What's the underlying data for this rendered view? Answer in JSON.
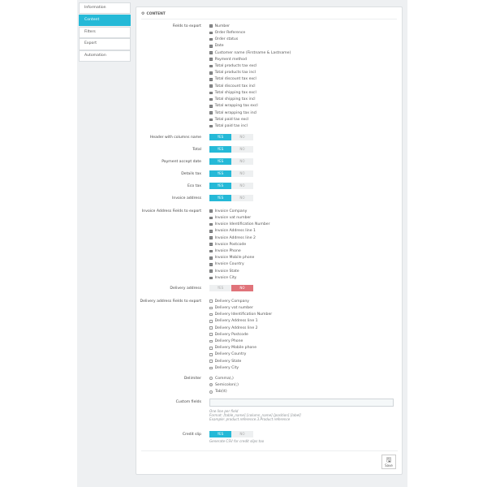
{
  "sidebar": {
    "items": [
      {
        "label": "Information"
      },
      {
        "label": "Content"
      },
      {
        "label": "Filters"
      },
      {
        "label": "Export"
      },
      {
        "label": "Automation"
      }
    ]
  },
  "panel": {
    "title": "CONTENT"
  },
  "fields_to_export": {
    "label": "Fields to export",
    "items": [
      "Number",
      "Order Reference",
      "Order status",
      "Date",
      "Customer name (Firstname & Lastname)",
      "Payment method",
      "Total products tax excl",
      "Total products tax incl",
      "Total discount tax excl",
      "Total discount tax incl",
      "Total shipping tax excl",
      "Total shipping tax incl",
      "Total wrapping tax excl",
      "Total wrapping tax incl",
      "Total paid tax excl",
      "Total paid tax incl"
    ]
  },
  "toggles": {
    "yes_label": "YES",
    "no_label": "NO",
    "header_columns": {
      "label": "Header with columns name",
      "value": "YES"
    },
    "total": {
      "label": "Total",
      "value": "YES"
    },
    "payment_accept_date": {
      "label": "Payment accept date",
      "value": "YES"
    },
    "details_tax": {
      "label": "Details tax",
      "value": "YES"
    },
    "eco_tax": {
      "label": "Eco tax",
      "value": "YES"
    },
    "invoice_address": {
      "label": "Invoice address",
      "value": "YES"
    },
    "delivery_address": {
      "label": "Delivery address",
      "value": "NO"
    },
    "credit_slip": {
      "label": "Credit slip",
      "value": "YES"
    }
  },
  "invoice_fields": {
    "label": "Invoice Address Fields to export",
    "items": [
      "Invoice Company",
      "Invoice vat number",
      "Invoice Identification Number",
      "Invoice Address line 1",
      "Invoice Address line 2",
      "Invoice Postcode",
      "Invoice Phone",
      "Invoice Mobile phone",
      "Invoice Country",
      "Invoice State",
      "Invoice City"
    ]
  },
  "delivery_fields": {
    "label": "Delivery address Fields to export",
    "items": [
      "Delivery Company",
      "Delivery vat number",
      "Delivery Identification Number",
      "Delivery Address line 1",
      "Delivery Address line 2",
      "Delivery Postcode",
      "Delivery Phone",
      "Delivery Mobile phone",
      "Delivery Country",
      "Delivery State",
      "Delivery City"
    ]
  },
  "delimiter": {
    "label": "Delimiter",
    "options": [
      "Comma(,)",
      "Semicolon(;)",
      "Tab(\\t)"
    ],
    "selected": "Semicolon(;)"
  },
  "custom_fields": {
    "label": "Custom fields",
    "value": "",
    "help": [
      "One line per field",
      "Format: [table_name].[column_name].[position].[label]",
      "Example: product.reference.3.Product reference"
    ]
  },
  "credit_slip_help": "Generate CSV for credit slips too",
  "save": {
    "label": "Save"
  },
  "colors": {
    "accent": "#25b9d7",
    "no_active": "#e0737a"
  }
}
